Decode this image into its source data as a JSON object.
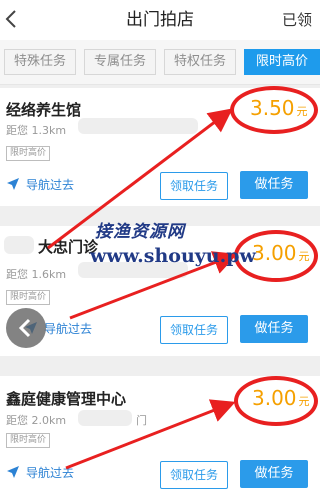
{
  "header": {
    "title": "出门拍店",
    "right_label": "已领"
  },
  "tabs": [
    {
      "label": "特殊任务",
      "active": false
    },
    {
      "label": "专属任务",
      "active": false
    },
    {
      "label": "特权任务",
      "active": false
    },
    {
      "label": "限时高价",
      "active": true
    }
  ],
  "cards": [
    {
      "name": "经络养生馆",
      "distance": "距您 1.3km",
      "tag": "限时高价",
      "price": "3.50",
      "unit": "元",
      "nav": "导航过去",
      "claim": "领取任务",
      "do": "做任务"
    },
    {
      "name": "大忠门诊",
      "distance": "距您 1.6km",
      "tag": "限时高价",
      "price": "3.00",
      "unit": "元",
      "nav": "导航过去",
      "claim": "领取任务",
      "do": "做任务"
    },
    {
      "name": "鑫庭健康管理中心",
      "distance": "距您 2.0km",
      "distance_suffix": "门",
      "tag": "限时高价",
      "price": "3.00",
      "unit": "元",
      "nav": "导航过去",
      "claim": "领取任务",
      "do": "做任务"
    }
  ],
  "watermark": {
    "cn": "接渔资源网",
    "url": "www.shouyu.pw"
  },
  "colors": {
    "accent": "#1e9bec",
    "price": "#f5a000",
    "annotation": "#e82020"
  }
}
